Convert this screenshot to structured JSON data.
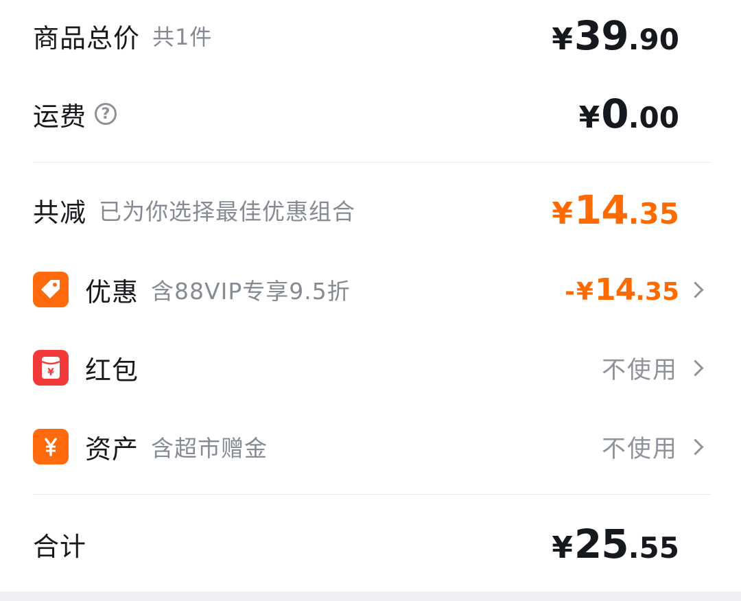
{
  "goods_total": {
    "title": "商品总价",
    "count_note": "共1件",
    "currency": "¥",
    "int": "39",
    "dec": ".90"
  },
  "shipping": {
    "title": "运费",
    "help_icon": "question-circle-icon",
    "help_glyph": "?",
    "currency": "¥",
    "int": "0",
    "dec": ".00"
  },
  "discount_total": {
    "title": "共减",
    "note": "已为你选择最佳优惠组合",
    "currency": "¥",
    "int": "14",
    "dec": ".35"
  },
  "coupon": {
    "title": "优惠",
    "note": "含88VIP专享9.5折",
    "icon": "tag-icon",
    "sign": "-",
    "currency": "¥",
    "int": "14",
    "dec": ".35"
  },
  "red_packet": {
    "title": "红包",
    "icon": "red-packet-icon",
    "value": "不使用"
  },
  "assets": {
    "title": "资产",
    "note": "含超市赠金",
    "icon": "yuan-coin-icon",
    "value": "不使用"
  },
  "grand_total": {
    "title": "合计",
    "currency": "¥",
    "int": "25",
    "dec": ".55"
  },
  "colors": {
    "accent_orange": "#ff6a00",
    "red_badge": "#f23a3a",
    "text_dark": "#15181d",
    "text_muted": "#868b93"
  }
}
